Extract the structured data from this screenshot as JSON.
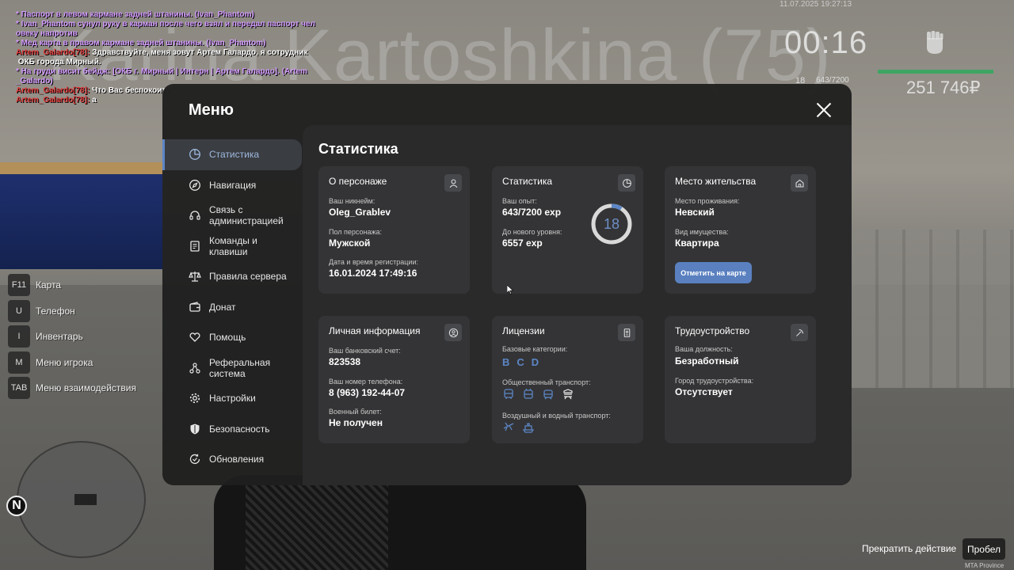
{
  "background": {
    "big_name": "Karina Kartoshkina (75)"
  },
  "hud": {
    "date": "11.07.2025 19:27:13",
    "time": "00:16",
    "level": "18",
    "exp": "643/7200",
    "money": "251 746₽"
  },
  "chat": [
    {
      "parts": [
        {
          "c": "c-me",
          "t": "* Паспорт в левом кармане задней штанины. (Ivan_Phantom)"
        }
      ]
    },
    {
      "parts": [
        {
          "c": "c-me",
          "t": "* Ivan_Phantom сунул руку в карман после чего взял и передал паспорт чел\nовеку напротив"
        }
      ]
    },
    {
      "parts": [
        {
          "c": "c-me",
          "t": "* Мед карта в правом кармане задней штанины. (Ivan_Phantom)"
        }
      ]
    },
    {
      "parts": [
        {
          "c": "c-red",
          "t": "Artem_Galardo[78]: "
        },
        {
          "c": "c-white",
          "t": "Здравствуйте, меня зовут Артем Галардо, я сотрудник\n ОКБ города Мирный."
        }
      ]
    },
    {
      "parts": [
        {
          "c": "c-me",
          "t": "* На груди висит бейдж: [ОКБ г. Мирный | Интерн | Артем Галардо]. (Artem\n_Galardo)"
        }
      ]
    },
    {
      "parts": [
        {
          "c": "c-red",
          "t": "Artem_Galardo[78]: "
        },
        {
          "c": "c-white",
          "t": "Что Вас беспокоит?"
        }
      ]
    },
    {
      "parts": [
        {
          "c": "c-red",
          "t": "Artem_Galardo[78]: "
        },
        {
          "c": "c-white",
          "t": "а"
        }
      ]
    }
  ],
  "hotkeys": [
    {
      "key": "F11",
      "label": "Карта"
    },
    {
      "key": "U",
      "label": "Телефон"
    },
    {
      "key": "I",
      "label": "Инвентарь"
    },
    {
      "key": "M",
      "label": "Меню игрока"
    },
    {
      "key": "TAB",
      "label": "Меню взаимодействия"
    }
  ],
  "radar": {
    "north": "N"
  },
  "bottom": {
    "stop_action": "Прекратить действие",
    "space_key": "Пробел",
    "server": "MTA Province"
  },
  "menu": {
    "title": "Меню",
    "sidebar": [
      {
        "label": "Статистика",
        "icon": "pie-chart-icon"
      },
      {
        "label": "Навигация",
        "icon": "compass-icon"
      },
      {
        "label": "Связь с\nадминистрацией",
        "icon": "headset-icon"
      },
      {
        "label": "Команды и\nклавиши",
        "icon": "document-icon"
      },
      {
        "label": "Правила сервера",
        "icon": "scales-icon"
      },
      {
        "label": "Донат",
        "icon": "wallet-icon"
      },
      {
        "label": "Помощь",
        "icon": "heart-hand-icon"
      },
      {
        "label": "Реферальная\nсистема",
        "icon": "network-icon"
      },
      {
        "label": "Настройки",
        "icon": "gear-icon"
      },
      {
        "label": "Безопасность",
        "icon": "shield-icon"
      },
      {
        "label": "Обновления",
        "icon": "refresh-check-icon"
      }
    ],
    "content_title": "Статистика",
    "character": {
      "title": "О персонаже",
      "nick_label": "Ваш никнейм:",
      "nick": "Oleg_Grablev",
      "gender_label": "Пол персонажа:",
      "gender": "Мужской",
      "reg_label": "Дата и время регистрации:",
      "reg": "16.01.2024 17:49:16"
    },
    "stats": {
      "title": "Статистика",
      "exp_label": "Ваш опыт:",
      "exp": "643/7200 exp",
      "next_label": "До нового уровня:",
      "next": "6557 exp",
      "level": "18",
      "level_progress": 0.0893
    },
    "residence": {
      "title": "Место жительства",
      "place_label": "Место проживания:",
      "place": "Невский",
      "type_label": "Вид имущества:",
      "type": "Квартира",
      "map_button": "Отметить на карте"
    },
    "personal": {
      "title": "Личная информация",
      "bank_label": "Ваш банковский счет:",
      "bank": "823538",
      "phone_label": "Ваш номер телефона:",
      "phone": "8 (963) 192-44-07",
      "military_label": "Военный билет:",
      "military": "Не получен"
    },
    "licenses": {
      "title": "Лицензии",
      "base_label": "Базовые категории:",
      "categories": [
        "B",
        "C",
        "D"
      ],
      "public_label": "Общественный транспорт:",
      "air_label": "Воздушный и водный транспорт:"
    },
    "job": {
      "title": "Трудоустройство",
      "position_label": "Ваша должность:",
      "position": "Безработный",
      "city_label": "Город трудоустройства:",
      "city": "Отсутствует"
    }
  },
  "colors": {
    "accent": "#5c86c6",
    "panel": "#1f1f1f",
    "card": "#343436",
    "money_bar": "#3fa563"
  }
}
